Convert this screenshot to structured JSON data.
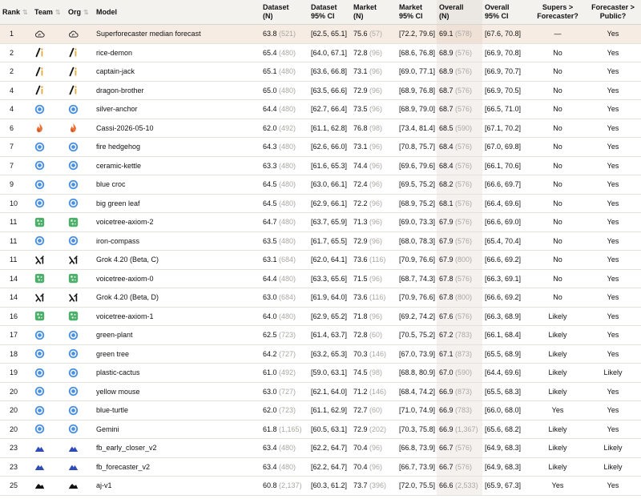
{
  "headers": {
    "rank": "Rank",
    "team": "Team",
    "org": "Org",
    "model": "Model",
    "dataset": [
      "Dataset",
      "(N)"
    ],
    "dataset_ci": [
      "Dataset",
      "95% CI"
    ],
    "market": [
      "Market",
      "(N)"
    ],
    "market_ci": [
      "Market",
      "95% CI"
    ],
    "overall": [
      "Overall",
      "(N)"
    ],
    "overall_ci": [
      "Overall",
      "95% CI"
    ],
    "supers": [
      "Supers >",
      "Forecaster?"
    ],
    "public": [
      "Forecaster >",
      "Public?"
    ]
  },
  "sort_icon": "⇅",
  "rows": [
    {
      "rank": "1",
      "team_icon": "cloud-outline-icon",
      "org_icon": "cloud-outline-icon",
      "model": "Superforecaster median forecast",
      "dataset": "63.8",
      "dataset_n": "(521)",
      "dataset_ci": "[62.5, 65.1]",
      "market": "75.6",
      "market_n": "(57)",
      "market_ci": "[72.2, 79.6]",
      "overall": "69.1",
      "overall_n": "(578)",
      "overall_ci": "[67.6, 70.8]",
      "supers": "—",
      "public": "Yes",
      "highlight": true
    },
    {
      "rank": "2",
      "team_icon": "slash-i-icon",
      "org_icon": "slash-i-icon",
      "model": "rice-demon",
      "dataset": "65.4",
      "dataset_n": "(480)",
      "dataset_ci": "[64.0, 67.1]",
      "market": "72.8",
      "market_n": "(96)",
      "market_ci": "[68.6, 76.8]",
      "overall": "68.9",
      "overall_n": "(576)",
      "overall_ci": "[66.9, 70.8]",
      "supers": "No",
      "public": "Yes"
    },
    {
      "rank": "2",
      "team_icon": "slash-i-icon",
      "org_icon": "slash-i-icon",
      "model": "captain-jack",
      "dataset": "65.1",
      "dataset_n": "(480)",
      "dataset_ci": "[63.6, 66.8]",
      "market": "73.1",
      "market_n": "(96)",
      "market_ci": "[69.0, 77.1]",
      "overall": "68.9",
      "overall_n": "(576)",
      "overall_ci": "[66.9, 70.7]",
      "supers": "No",
      "public": "Yes"
    },
    {
      "rank": "4",
      "team_icon": "slash-i-icon",
      "org_icon": "slash-i-icon",
      "model": "dragon-brother",
      "dataset": "65.0",
      "dataset_n": "(480)",
      "dataset_ci": "[63.5, 66.6]",
      "market": "72.9",
      "market_n": "(96)",
      "market_ci": "[68.9, 76.8]",
      "overall": "68.7",
      "overall_n": "(576)",
      "overall_ci": "[66.9, 70.5]",
      "supers": "No",
      "public": "Yes"
    },
    {
      "rank": "4",
      "team_icon": "blue-ring-icon",
      "org_icon": "blue-ring-icon",
      "model": "silver-anchor",
      "dataset": "64.4",
      "dataset_n": "(480)",
      "dataset_ci": "[62.7, 66.4]",
      "market": "73.5",
      "market_n": "(96)",
      "market_ci": "[68.9, 79.0]",
      "overall": "68.7",
      "overall_n": "(576)",
      "overall_ci": "[66.5, 71.0]",
      "supers": "No",
      "public": "Yes"
    },
    {
      "rank": "6",
      "team_icon": "flame-icon",
      "org_icon": "flame-icon",
      "model": "Cassi-2026-05-10",
      "dataset": "62.0",
      "dataset_n": "(492)",
      "dataset_ci": "[61.1, 62.8]",
      "market": "76.8",
      "market_n": "(98)",
      "market_ci": "[73.4, 81.4]",
      "overall": "68.5",
      "overall_n": "(590)",
      "overall_ci": "[67.1, 70.2]",
      "supers": "No",
      "public": "Yes"
    },
    {
      "rank": "7",
      "team_icon": "blue-ring-icon",
      "org_icon": "blue-ring-icon",
      "model": "fire hedgehog",
      "dataset": "64.3",
      "dataset_n": "(480)",
      "dataset_ci": "[62.6, 66.0]",
      "market": "73.1",
      "market_n": "(96)",
      "market_ci": "[70.8, 75.7]",
      "overall": "68.4",
      "overall_n": "(576)",
      "overall_ci": "[67.0, 69.8]",
      "supers": "No",
      "public": "Yes"
    },
    {
      "rank": "7",
      "team_icon": "blue-ring-icon",
      "org_icon": "blue-ring-icon",
      "model": "ceramic-kettle",
      "dataset": "63.3",
      "dataset_n": "(480)",
      "dataset_ci": "[61.6, 65.3]",
      "market": "74.4",
      "market_n": "(96)",
      "market_ci": "[69.6, 79.6]",
      "overall": "68.4",
      "overall_n": "(576)",
      "overall_ci": "[66.1, 70.6]",
      "supers": "No",
      "public": "Yes"
    },
    {
      "rank": "9",
      "team_icon": "blue-ring-icon",
      "org_icon": "blue-ring-icon",
      "model": "blue croc",
      "dataset": "64.5",
      "dataset_n": "(480)",
      "dataset_ci": "[63.0, 66.1]",
      "market": "72.4",
      "market_n": "(96)",
      "market_ci": "[69.5, 75.2]",
      "overall": "68.2",
      "overall_n": "(576)",
      "overall_ci": "[66.6, 69.7]",
      "supers": "No",
      "public": "Yes"
    },
    {
      "rank": "10",
      "team_icon": "blue-ring-icon",
      "org_icon": "blue-ring-icon",
      "model": "big green leaf",
      "dataset": "64.5",
      "dataset_n": "(480)",
      "dataset_ci": "[62.9, 66.1]",
      "market": "72.2",
      "market_n": "(96)",
      "market_ci": "[68.9, 75.2]",
      "overall": "68.1",
      "overall_n": "(576)",
      "overall_ci": "[66.4, 69.6]",
      "supers": "No",
      "public": "Yes"
    },
    {
      "rank": "11",
      "team_icon": "green-tile-icon",
      "org_icon": "green-tile-icon",
      "model": "voicetree-axiom-2",
      "dataset": "64.7",
      "dataset_n": "(480)",
      "dataset_ci": "[63.7, 65.9]",
      "market": "71.3",
      "market_n": "(96)",
      "market_ci": "[69.0, 73.3]",
      "overall": "67.9",
      "overall_n": "(576)",
      "overall_ci": "[66.6, 69.0]",
      "supers": "No",
      "public": "Yes"
    },
    {
      "rank": "11",
      "team_icon": "blue-ring-icon",
      "org_icon": "blue-ring-icon",
      "model": "iron-compass",
      "dataset": "63.5",
      "dataset_n": "(480)",
      "dataset_ci": "[61.7, 65.5]",
      "market": "72.9",
      "market_n": "(96)",
      "market_ci": "[68.0, 78.3]",
      "overall": "67.9",
      "overall_n": "(576)",
      "overall_ci": "[65.4, 70.4]",
      "supers": "No",
      "public": "Yes"
    },
    {
      "rank": "11",
      "team_icon": "xai-icon",
      "org_icon": "xai-icon",
      "model": "Grok 4.20 (Beta, C)",
      "dataset": "63.1",
      "dataset_n": "(684)",
      "dataset_ci": "[62.0, 64.1]",
      "market": "73.6",
      "market_n": "(116)",
      "market_ci": "[70.9, 76.6]",
      "overall": "67.9",
      "overall_n": "(800)",
      "overall_ci": "[66.6, 69.2]",
      "supers": "No",
      "public": "Yes"
    },
    {
      "rank": "14",
      "team_icon": "green-tile-icon",
      "org_icon": "green-tile-icon",
      "model": "voicetree-axiom-0",
      "dataset": "64.4",
      "dataset_n": "(480)",
      "dataset_ci": "[63.3, 65.6]",
      "market": "71.5",
      "market_n": "(96)",
      "market_ci": "[68.7, 74.3]",
      "overall": "67.8",
      "overall_n": "(576)",
      "overall_ci": "[66.3, 69.1]",
      "supers": "No",
      "public": "Yes"
    },
    {
      "rank": "14",
      "team_icon": "xai-icon",
      "org_icon": "xai-icon",
      "model": "Grok 4.20 (Beta, D)",
      "dataset": "63.0",
      "dataset_n": "(684)",
      "dataset_ci": "[61.9, 64.0]",
      "market": "73.6",
      "market_n": "(116)",
      "market_ci": "[70.9, 76.6]",
      "overall": "67.8",
      "overall_n": "(800)",
      "overall_ci": "[66.6, 69.2]",
      "supers": "No",
      "public": "Yes"
    },
    {
      "rank": "16",
      "team_icon": "green-tile-icon",
      "org_icon": "green-tile-icon",
      "model": "voicetree-axiom-1",
      "dataset": "64.0",
      "dataset_n": "(480)",
      "dataset_ci": "[62.9, 65.2]",
      "market": "71.8",
      "market_n": "(96)",
      "market_ci": "[69.2, 74.2]",
      "overall": "67.6",
      "overall_n": "(576)",
      "overall_ci": "[66.3, 68.9]",
      "supers": "Likely",
      "public": "Yes"
    },
    {
      "rank": "17",
      "team_icon": "blue-ring-icon",
      "org_icon": "blue-ring-icon",
      "model": "green-plant",
      "dataset": "62.5",
      "dataset_n": "(723)",
      "dataset_ci": "[61.4, 63.7]",
      "market": "72.8",
      "market_n": "(60)",
      "market_ci": "[70.5, 75.2]",
      "overall": "67.2",
      "overall_n": "(783)",
      "overall_ci": "[66.1, 68.4]",
      "supers": "Likely",
      "public": "Yes"
    },
    {
      "rank": "18",
      "team_icon": "blue-ring-icon",
      "org_icon": "blue-ring-icon",
      "model": "green tree",
      "dataset": "64.2",
      "dataset_n": "(727)",
      "dataset_ci": "[63.2, 65.3]",
      "market": "70.3",
      "market_n": "(146)",
      "market_ci": "[67.0, 73.9]",
      "overall": "67.1",
      "overall_n": "(873)",
      "overall_ci": "[65.5, 68.9]",
      "supers": "Likely",
      "public": "Yes"
    },
    {
      "rank": "19",
      "team_icon": "blue-ring-icon",
      "org_icon": "blue-ring-icon",
      "model": "plastic-cactus",
      "dataset": "61.0",
      "dataset_n": "(492)",
      "dataset_ci": "[59.0, 63.1]",
      "market": "74.5",
      "market_n": "(98)",
      "market_ci": "[68.8, 80.9]",
      "overall": "67.0",
      "overall_n": "(590)",
      "overall_ci": "[64.4, 69.6]",
      "supers": "Likely",
      "public": "Likely"
    },
    {
      "rank": "20",
      "team_icon": "blue-ring-icon",
      "org_icon": "blue-ring-icon",
      "model": "yellow mouse",
      "dataset": "63.0",
      "dataset_n": "(727)",
      "dataset_ci": "[62.1, 64.0]",
      "market": "71.2",
      "market_n": "(146)",
      "market_ci": "[68.4, 74.2]",
      "overall": "66.9",
      "overall_n": "(873)",
      "overall_ci": "[65.5, 68.3]",
      "supers": "Likely",
      "public": "Yes"
    },
    {
      "rank": "20",
      "team_icon": "blue-ring-icon",
      "org_icon": "blue-ring-icon",
      "model": "blue-turtle",
      "dataset": "62.0",
      "dataset_n": "(723)",
      "dataset_ci": "[61.1, 62.9]",
      "market": "72.7",
      "market_n": "(60)",
      "market_ci": "[71.0, 74.9]",
      "overall": "66.9",
      "overall_n": "(783)",
      "overall_ci": "[66.0, 68.0]",
      "supers": "Yes",
      "public": "Yes"
    },
    {
      "rank": "20",
      "team_icon": "blue-ring-icon",
      "org_icon": "blue-ring-icon",
      "model": "Gemini",
      "dataset": "61.8",
      "dataset_n": "(1,165)",
      "dataset_ci": "[60.5, 63.1]",
      "market": "72.9",
      "market_n": "(202)",
      "market_ci": "[70.3, 75.8]",
      "overall": "66.9",
      "overall_n": "(1,367)",
      "overall_ci": "[65.6, 68.2]",
      "supers": "Likely",
      "public": "Yes"
    },
    {
      "rank": "23",
      "team_icon": "mountain-blue-icon",
      "org_icon": "mountain-blue-icon",
      "model": "fb_early_closer_v2",
      "dataset": "63.4",
      "dataset_n": "(480)",
      "dataset_ci": "[62.2, 64.7]",
      "market": "70.4",
      "market_n": "(96)",
      "market_ci": "[66.8, 73.9]",
      "overall": "66.7",
      "overall_n": "(576)",
      "overall_ci": "[64.9, 68.3]",
      "supers": "Likely",
      "public": "Likely"
    },
    {
      "rank": "23",
      "team_icon": "mountain-blue-icon",
      "org_icon": "mountain-blue-icon",
      "model": "fb_forecaster_v2",
      "dataset": "63.4",
      "dataset_n": "(480)",
      "dataset_ci": "[62.2, 64.7]",
      "market": "70.4",
      "market_n": "(96)",
      "market_ci": "[66.7, 73.9]",
      "overall": "66.7",
      "overall_n": "(576)",
      "overall_ci": "[64.9, 68.3]",
      "supers": "Likely",
      "public": "Likely"
    },
    {
      "rank": "25",
      "team_icon": "mountain-black-icon",
      "org_icon": "mountain-black-icon",
      "model": "aj-v1",
      "dataset": "60.8",
      "dataset_n": "(2,137)",
      "dataset_ci": "[60.3, 61.2]",
      "market": "73.7",
      "market_n": "(396)",
      "market_ci": "[72.0, 75.5]",
      "overall": "66.6",
      "overall_n": "(2,533)",
      "overall_ci": "[65.9, 67.3]",
      "supers": "Yes",
      "public": "Yes"
    }
  ]
}
